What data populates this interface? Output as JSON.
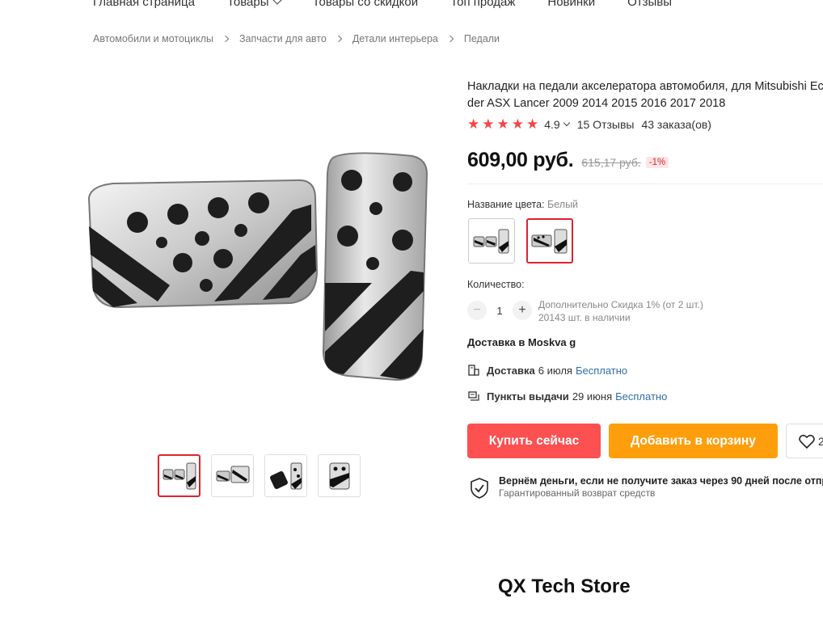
{
  "nav": {
    "items": [
      "Главная страница",
      "Товары",
      "Товары со скидкой",
      "Топ продаж",
      "Новинки",
      "Отзывы"
    ]
  },
  "breadcrumbs": [
    "Автомобили и мотоциклы",
    "Запчасти для авто",
    "Детали интерьера",
    "Педали"
  ],
  "product": {
    "title_line1": "Накладки на педали акселератора автомобиля, для Mitsubishi Ecli",
    "title_line2": "der ASX Lancer 2009 2014 2015 2016 2017 2018",
    "rating": "4.9",
    "rating_stars": 5,
    "reviews": "15 Отзывы",
    "orders": "43 заказа(ов)",
    "price": "609,00 руб.",
    "old_price": "615,17 руб.",
    "discount": "-1%"
  },
  "color": {
    "label": "Название цвета:",
    "value": "Белый"
  },
  "quantity": {
    "label": "Количество:",
    "minus": "−",
    "value": "1",
    "plus": "+",
    "extra_discount": "Дополнительно Скидка 1% (от 2 шт.)",
    "stock": "20143 шт. в наличии"
  },
  "delivery": {
    "to": "Доставка в Moskva g",
    "courier_label": "Доставка",
    "courier_date": "6 июля",
    "courier_price": "Бесплатно",
    "pickup_label": "Пункты выдачи",
    "pickup_date": "29 июня",
    "pickup_price": "Бесплатно"
  },
  "actions": {
    "buy": "Купить сейчас",
    "cart": "Добавить в корзину",
    "wishlist_count": "2"
  },
  "guarantee": {
    "title": "Вернём деньги, если не получите заказ через 90 дней после отпр",
    "subtitle": "Гарантированный возврат средств"
  },
  "store": {
    "name": "QX Tech Store"
  },
  "colors": {
    "accent_red": "#fd5050",
    "accent_orange": "#ff9e0d",
    "star": "#f54545",
    "link_blue": "#2f6ea8"
  }
}
